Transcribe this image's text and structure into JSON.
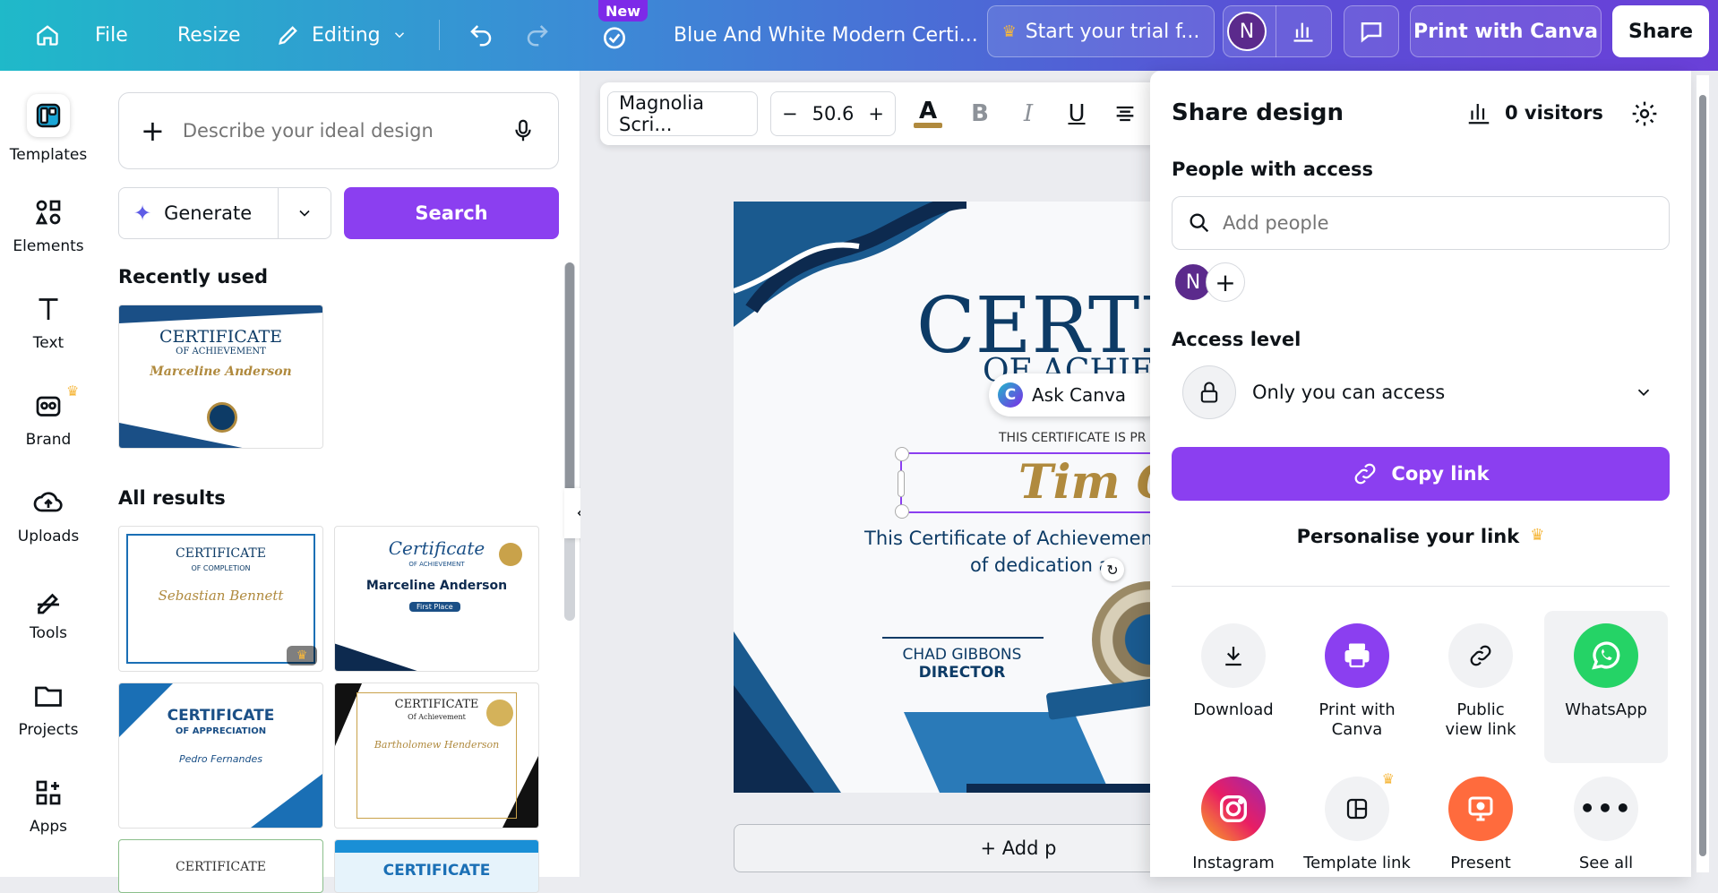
{
  "topbar": {
    "file": "File",
    "resize": "Resize",
    "editing": "Editing",
    "new_badge": "New",
    "doc_title": "Blue And White Modern Certi...",
    "trial": "Start your trial f...",
    "avatar": "N",
    "print": "Print with Canva",
    "share": "Share"
  },
  "rail": [
    {
      "label": "Templates",
      "icon": "templates-icon"
    },
    {
      "label": "Elements",
      "icon": "elements-icon"
    },
    {
      "label": "Text",
      "icon": "text-icon"
    },
    {
      "label": "Brand",
      "icon": "brand-icon"
    },
    {
      "label": "Uploads",
      "icon": "uploads-icon"
    },
    {
      "label": "Tools",
      "icon": "tools-icon"
    },
    {
      "label": "Projects",
      "icon": "projects-icon"
    },
    {
      "label": "Apps",
      "icon": "apps-icon"
    }
  ],
  "panel": {
    "describe_placeholder": "Describe your ideal design",
    "generate": "Generate",
    "search": "Search",
    "recently_used": "Recently used",
    "all_results": "All results",
    "thumbs": {
      "recent": {
        "title": "CERTIFICATE",
        "sub": "OF ACHIEVEMENT",
        "name": "Marceline Anderson"
      },
      "t1": {
        "title": "CERTIFICATE",
        "sub": "OF COMPLETION",
        "name": "Sebastian Bennett"
      },
      "t2": {
        "title": "Certificate",
        "sub": "OF ACHIEVEMENT",
        "name": "Marceline Anderson",
        "badge": "First Place"
      },
      "t3": {
        "title": "CERTIFICATE",
        "sub": "OF APPRECIATION",
        "name": "Pedro Fernandes"
      },
      "t4": {
        "title": "CERTIFICATE",
        "sub": "Of Achievement",
        "name": "Bartholomew Henderson"
      },
      "t5": {
        "title": "CERTIFICATE"
      },
      "t6": {
        "title": "CERTIFICATE"
      }
    }
  },
  "toolbar": {
    "font": "Magnolia Scri...",
    "size": "50.6"
  },
  "certificate": {
    "title": "CERTIFI",
    "subtitle": "OF ACHIEV",
    "presented": "THIS CERTIFICATE IS PR",
    "name": "Tim C",
    "body1": "This Certificate of Achievemen",
    "body2": "of dedication a",
    "signer": "CHAD GIBBONS",
    "role": "DIRECTOR",
    "ask": "Ask Canva",
    "add_page": "+ Add p"
  },
  "share": {
    "title": "Share design",
    "visitors": "0 visitors",
    "people_label": "People with access",
    "add_people_placeholder": "Add people",
    "avatar": "N",
    "access_label": "Access level",
    "access_value": "Only you can access",
    "copy_link": "Copy link",
    "personalise": "Personalise your link",
    "options": [
      {
        "label": "Download",
        "icon": "download-icon"
      },
      {
        "label": "Print with Canva",
        "icon": "print-icon"
      },
      {
        "label": "Public view link",
        "icon": "link-icon"
      },
      {
        "label": "WhatsApp",
        "icon": "whatsapp-icon"
      },
      {
        "label": "Instagram",
        "icon": "instagram-icon"
      },
      {
        "label": "Template link",
        "icon": "template-link-icon"
      },
      {
        "label": "Present",
        "icon": "present-icon"
      },
      {
        "label": "See all",
        "icon": "more-icon"
      }
    ]
  },
  "colors": {
    "accent": "#7d2ae8",
    "navy": "#0d3b66",
    "gold": "#b08a3e"
  }
}
